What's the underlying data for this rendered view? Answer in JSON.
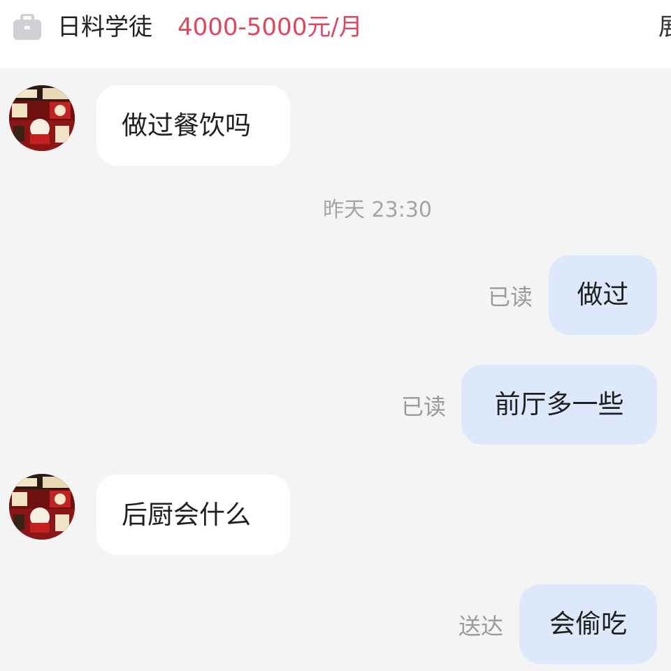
{
  "header": {
    "icon": "briefcase-icon",
    "job_title": "日料学徒",
    "salary": "4000-5000元/月",
    "right_cut_text": "展"
  },
  "colors": {
    "salary": "#e0455c",
    "incoming_bubble": "#ffffff",
    "outgoing_bubble": "#dde8fb",
    "background": "#f4f4f5"
  },
  "messages": [
    {
      "from": "other",
      "text": "做过餐饮吗"
    },
    {
      "type": "time",
      "text": "昨天 23:30"
    },
    {
      "from": "me",
      "text": "做过",
      "status": "已读"
    },
    {
      "from": "me",
      "text": "前厅多一些",
      "status": "已读"
    },
    {
      "from": "other",
      "text": "后厨会什么"
    },
    {
      "from": "me",
      "text": "会偷吃",
      "status": "送达"
    }
  ]
}
